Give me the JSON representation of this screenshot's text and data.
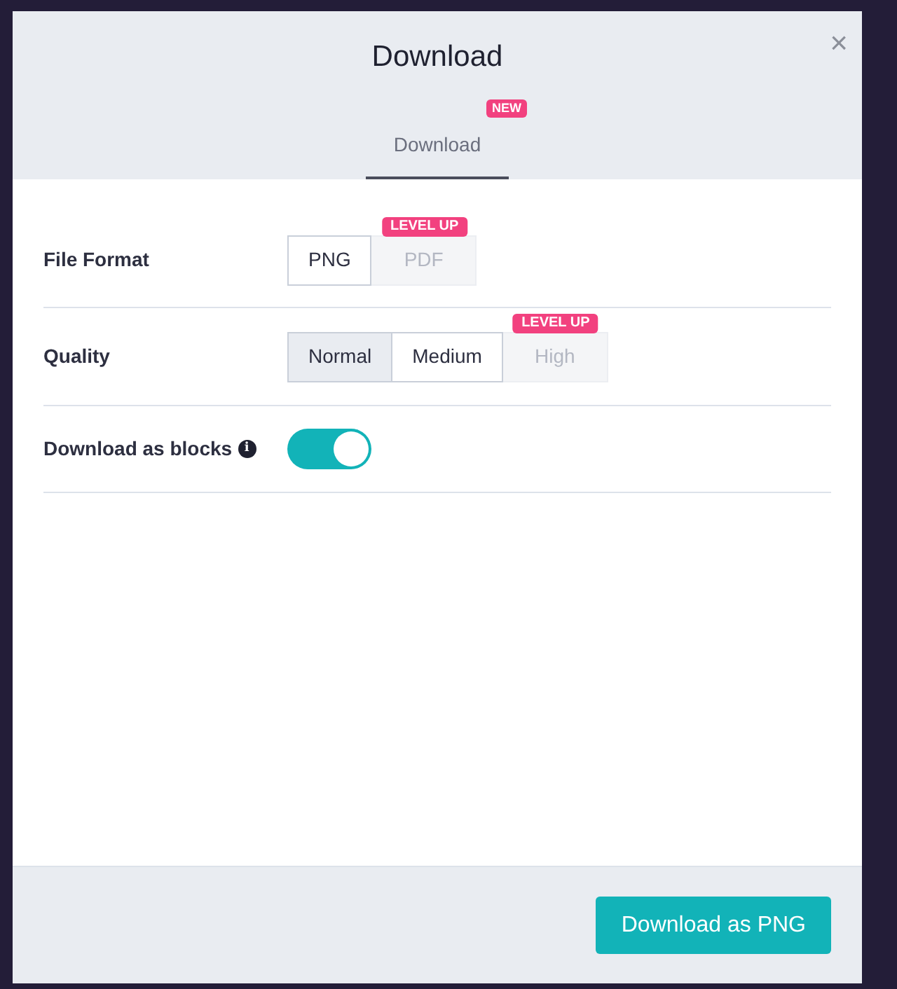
{
  "dialog": {
    "title": "Download",
    "close": "×"
  },
  "tabs": [
    {
      "label": "Download",
      "badge": "NEW",
      "selected": true
    }
  ],
  "settings": [
    {
      "kind": "options",
      "label": "File Format",
      "options": [
        {
          "label": "PNG",
          "selected": true,
          "disabled": false
        },
        {
          "label": "PDF",
          "selected": false,
          "disabled": true,
          "badge": "LEVEL UP"
        }
      ]
    },
    {
      "kind": "options",
      "label": "Quality",
      "options": [
        {
          "label": "Normal",
          "selected": false,
          "disabled": false
        },
        {
          "label": "Medium",
          "selected": true,
          "disabled": false
        },
        {
          "label": "High",
          "selected": false,
          "disabled": true,
          "badge": "LEVEL UP"
        }
      ]
    },
    {
      "kind": "toggle",
      "label": "Download as blocks",
      "info": "i",
      "on": true
    }
  ],
  "footer": {
    "button": "Download as PNG"
  }
}
